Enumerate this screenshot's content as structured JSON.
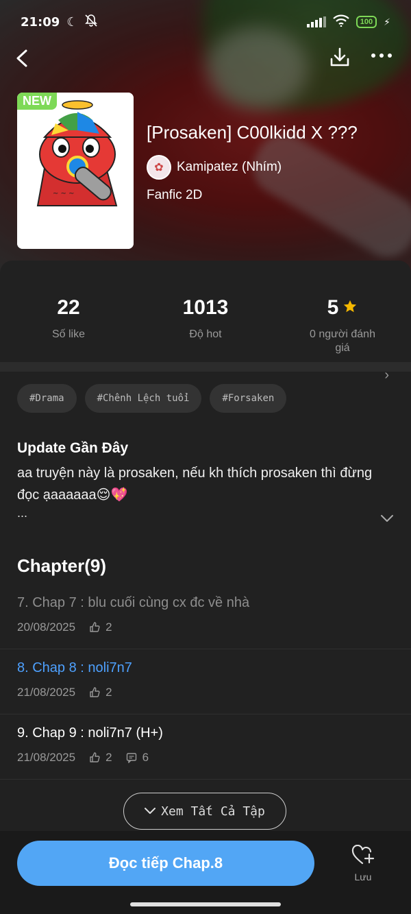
{
  "status_bar": {
    "time": "21:09",
    "battery": "100"
  },
  "story": {
    "badge": "NEW",
    "title": "[Prosaken] C00lkidd X ???",
    "author": "Kamipatez (Nhím)",
    "genre": "Fanfic 2D"
  },
  "stats": [
    {
      "value": "22",
      "label": "Số like"
    },
    {
      "value": "1013",
      "label": "Độ hot"
    },
    {
      "value": "5",
      "label": "0 người đánh giá"
    }
  ],
  "tags": [
    "#Drama",
    "#Chênh Lệch tuổi",
    "#Forsaken"
  ],
  "update": {
    "heading": "Update Gần Đây",
    "text": "aa truyện này là prosaken, nếu kh thích prosaken thì đừng đọc ạaaaaaa😌💖",
    "ellipsis": "..."
  },
  "chapters": {
    "heading": "Chapter(9)",
    "items": [
      {
        "title": "7. Chap 7 : blu cuối cùng cx đc về nhà",
        "date": "20/08/2025",
        "likes": "2",
        "comments": ""
      },
      {
        "title": "8. Chap 8 : noli7n7",
        "date": "21/08/2025",
        "likes": "2",
        "comments": ""
      },
      {
        "title": "9. Chap 9 : noli7n7 (H+)",
        "date": "21/08/2025",
        "likes": "2",
        "comments": "6"
      }
    ],
    "see_all": "Xem Tất Cả Tập"
  },
  "bottom": {
    "read_button": "Đọc tiếp Chap.8",
    "save_label": "Lưu"
  },
  "colors": {
    "accent": "#52a6f5",
    "new_badge": "#7ed957",
    "star": "#f5b800"
  }
}
